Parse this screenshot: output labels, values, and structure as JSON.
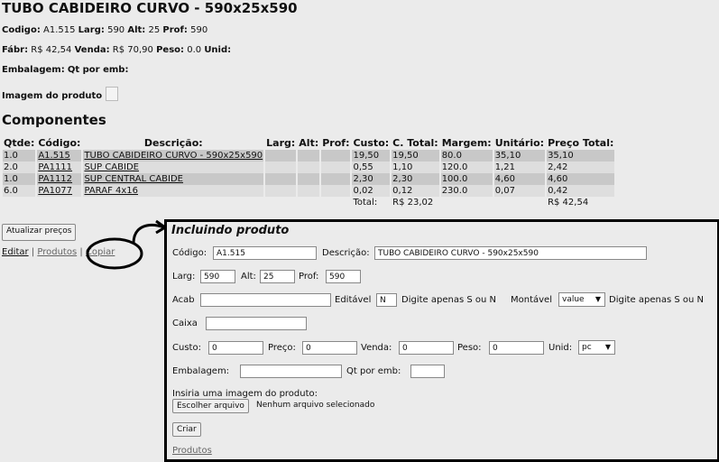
{
  "product": {
    "title": "TUBO CABIDEIRO CURVO - 590x25x590",
    "codigo_label": "Codigo:",
    "codigo": "A1.515",
    "larg_label": "Larg:",
    "larg": "590",
    "alt_label": "Alt:",
    "alt": "25",
    "prof_label": "Prof:",
    "prof": "590",
    "fabr_label": "Fábr:",
    "fabr": "R$ 42,54",
    "venda_label": "Venda:",
    "venda": "R$ 70,90",
    "peso_label": "Peso:",
    "peso": "0.0",
    "unid_label": "Unid:",
    "embalagem_label": "Embalagem:",
    "qt_label": "Qt por emb:",
    "imagem_label": "Imagem do produto"
  },
  "components": {
    "heading": "Componentes",
    "headers": [
      "Qtde:",
      "Código:",
      "Descrição:",
      "Larg:",
      "Alt:",
      "Prof:",
      "Custo:",
      "C. Total:",
      "Margem:",
      "Unitário:",
      "Preço Total:"
    ],
    "rows": [
      {
        "qtde": "1.0",
        "codigo": "A1.515",
        "descricao": "TUBO CABIDEIRO CURVO - 590x25x590",
        "larg": "",
        "alt": "",
        "prof": "",
        "custo": "19,50",
        "ctotal": "19,50",
        "margem": "80.0",
        "unitario": "35,10",
        "preco": "35,10"
      },
      {
        "qtde": "2.0",
        "codigo": "PA1111",
        "descricao": "SUP CABIDE",
        "larg": "",
        "alt": "",
        "prof": "",
        "custo": "0,55",
        "ctotal": "1,10",
        "margem": "120.0",
        "unitario": "1,21",
        "preco": "2,42"
      },
      {
        "qtde": "1.0",
        "codigo": "PA1112",
        "descricao": "SUP CENTRAL CABIDE",
        "larg": "",
        "alt": "",
        "prof": "",
        "custo": "2,30",
        "ctotal": "2,30",
        "margem": "100.0",
        "unitario": "4,60",
        "preco": "4,60"
      },
      {
        "qtde": "6.0",
        "codigo": "PA1077",
        "descricao": "PARAF 4x16",
        "larg": "",
        "alt": "",
        "prof": "",
        "custo": "0,02",
        "ctotal": "0,12",
        "margem": "230.0",
        "unitario": "0,07",
        "preco": "0,42"
      }
    ],
    "total_label": "Total:",
    "total_ctotal": "R$ 23,02",
    "total_preco": "R$ 42,54"
  },
  "actions": {
    "atualizar": "Atualizar preços",
    "editar": "Editar",
    "sep": "|",
    "produtos": "Produtos",
    "copiar": "Copiar"
  },
  "form": {
    "title": "Incluindo produto",
    "codigo_label": "Código:",
    "codigo_value": "A1.515",
    "descricao_label": "Descrição:",
    "descricao_value": "TUBO CABIDEIRO CURVO - 590x25x590",
    "larg_label": "Larg:",
    "larg_value": "590",
    "alt_label": "Alt:",
    "alt_value": "25",
    "prof_label": "Prof:",
    "prof_value": "590",
    "acab_label": "Acab",
    "acab_value": "",
    "editavel_label": "Editável",
    "editavel_value": "N",
    "editavel_hint": "Digite apenas S ou N",
    "montavel_label": "Montável",
    "montavel_value": "value",
    "montavel_hint": "Digite apenas S ou N",
    "caixa_label": "Caixa",
    "caixa_value": "",
    "custo_label": "Custo:",
    "custo_value": "0",
    "preco_label": "Preço:",
    "preco_value": "0",
    "venda_label": "Venda:",
    "venda_value": "0",
    "peso_label": "Peso:",
    "peso_value": "0",
    "unid_label": "Unid:",
    "unid_value": "pc",
    "embalagem_label": "Embalagem:",
    "embalagem_value": "",
    "qt_label": "Qt por emb:",
    "qt_value": "",
    "imagem_label": "Insiria uma imagem do produto:",
    "file_button": "Escolher arquivo",
    "file_status": "Nenhum arquivo selecionado",
    "criar": "Criar",
    "produtos_link": "Produtos"
  }
}
